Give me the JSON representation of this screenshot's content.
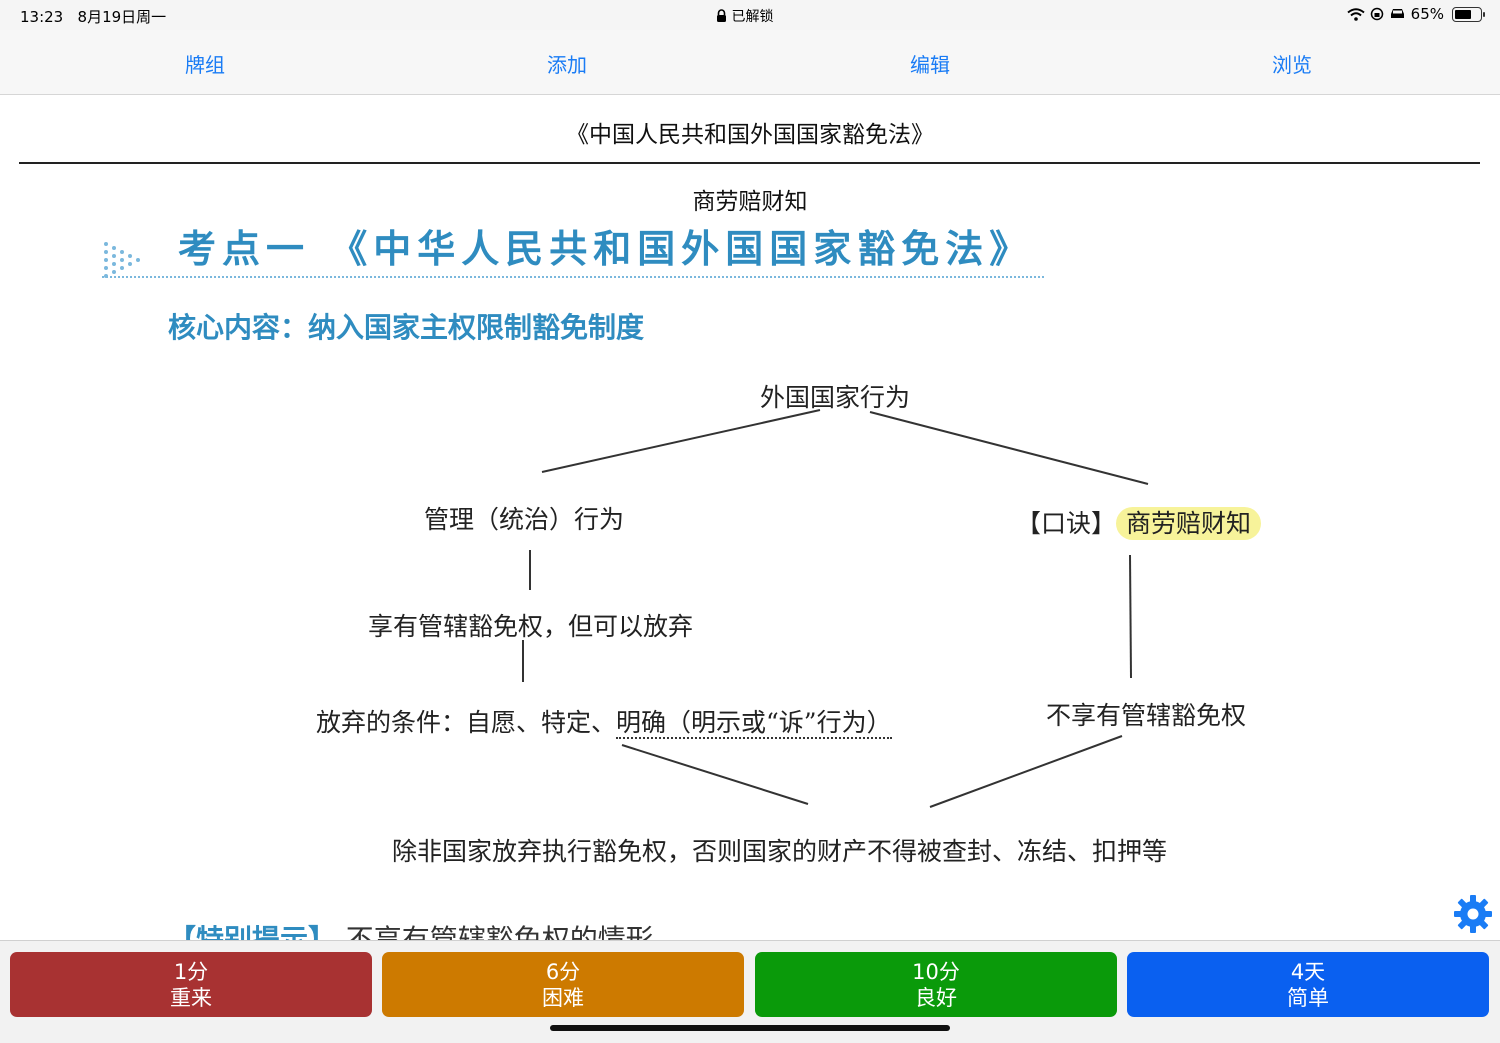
{
  "status_bar": {
    "time": "13:23",
    "date": "8月19日周一",
    "lock_status": "已解锁",
    "battery": "65%",
    "battery_level": 0.65
  },
  "toolbar": {
    "decks": "牌组",
    "add": "添加",
    "edit": "编辑",
    "browse": "浏览"
  },
  "card": {
    "title": "《中国人民共和国外国国家豁免法》",
    "answer": "商劳赔财知"
  },
  "scan": {
    "heading": "考点一 《中华人民共和国外国国家豁免法》",
    "subheading": "核心内容：纳入国家主权限制豁免制度",
    "root": "外国国家行为",
    "left_branch": "管理（统治）行为",
    "right_prefix": "【口诀】",
    "right_mnemonic": "商劳赔财知",
    "left_mid": "享有管辖豁免权，但可以放弃",
    "waiver_prefix": "放弃的条件：自愿、特定、",
    "waiver_underlined": "明确（明示或“诉”行为）",
    "right_mid": "不享有管辖豁免权",
    "conclusion": "除非国家放弃执行豁免权，否则国家的财产不得被查封、冻结、扣押等",
    "bottom_partial_label": "【特别提示】",
    "bottom_partial_text": "不享有管辖豁免权的情形"
  },
  "answers": [
    {
      "interval": "1分",
      "label": "重来",
      "color": "#a83232"
    },
    {
      "interval": "6分",
      "label": "困难",
      "color": "#cd7a00"
    },
    {
      "interval": "10分",
      "label": "良好",
      "color": "#0a9a0a"
    },
    {
      "interval": "4天",
      "label": "简单",
      "color": "#0a60f0"
    }
  ],
  "icons": {
    "settings": "gear-icon",
    "lock": "lock-icon",
    "wifi": "wifi-icon",
    "orientation_lock": "orientation-lock-icon",
    "car": "car-icon"
  },
  "colors": {
    "accent": "#1a7cf5",
    "scan_blue": "#2f8cc0",
    "highlight": "#f7f39a"
  }
}
